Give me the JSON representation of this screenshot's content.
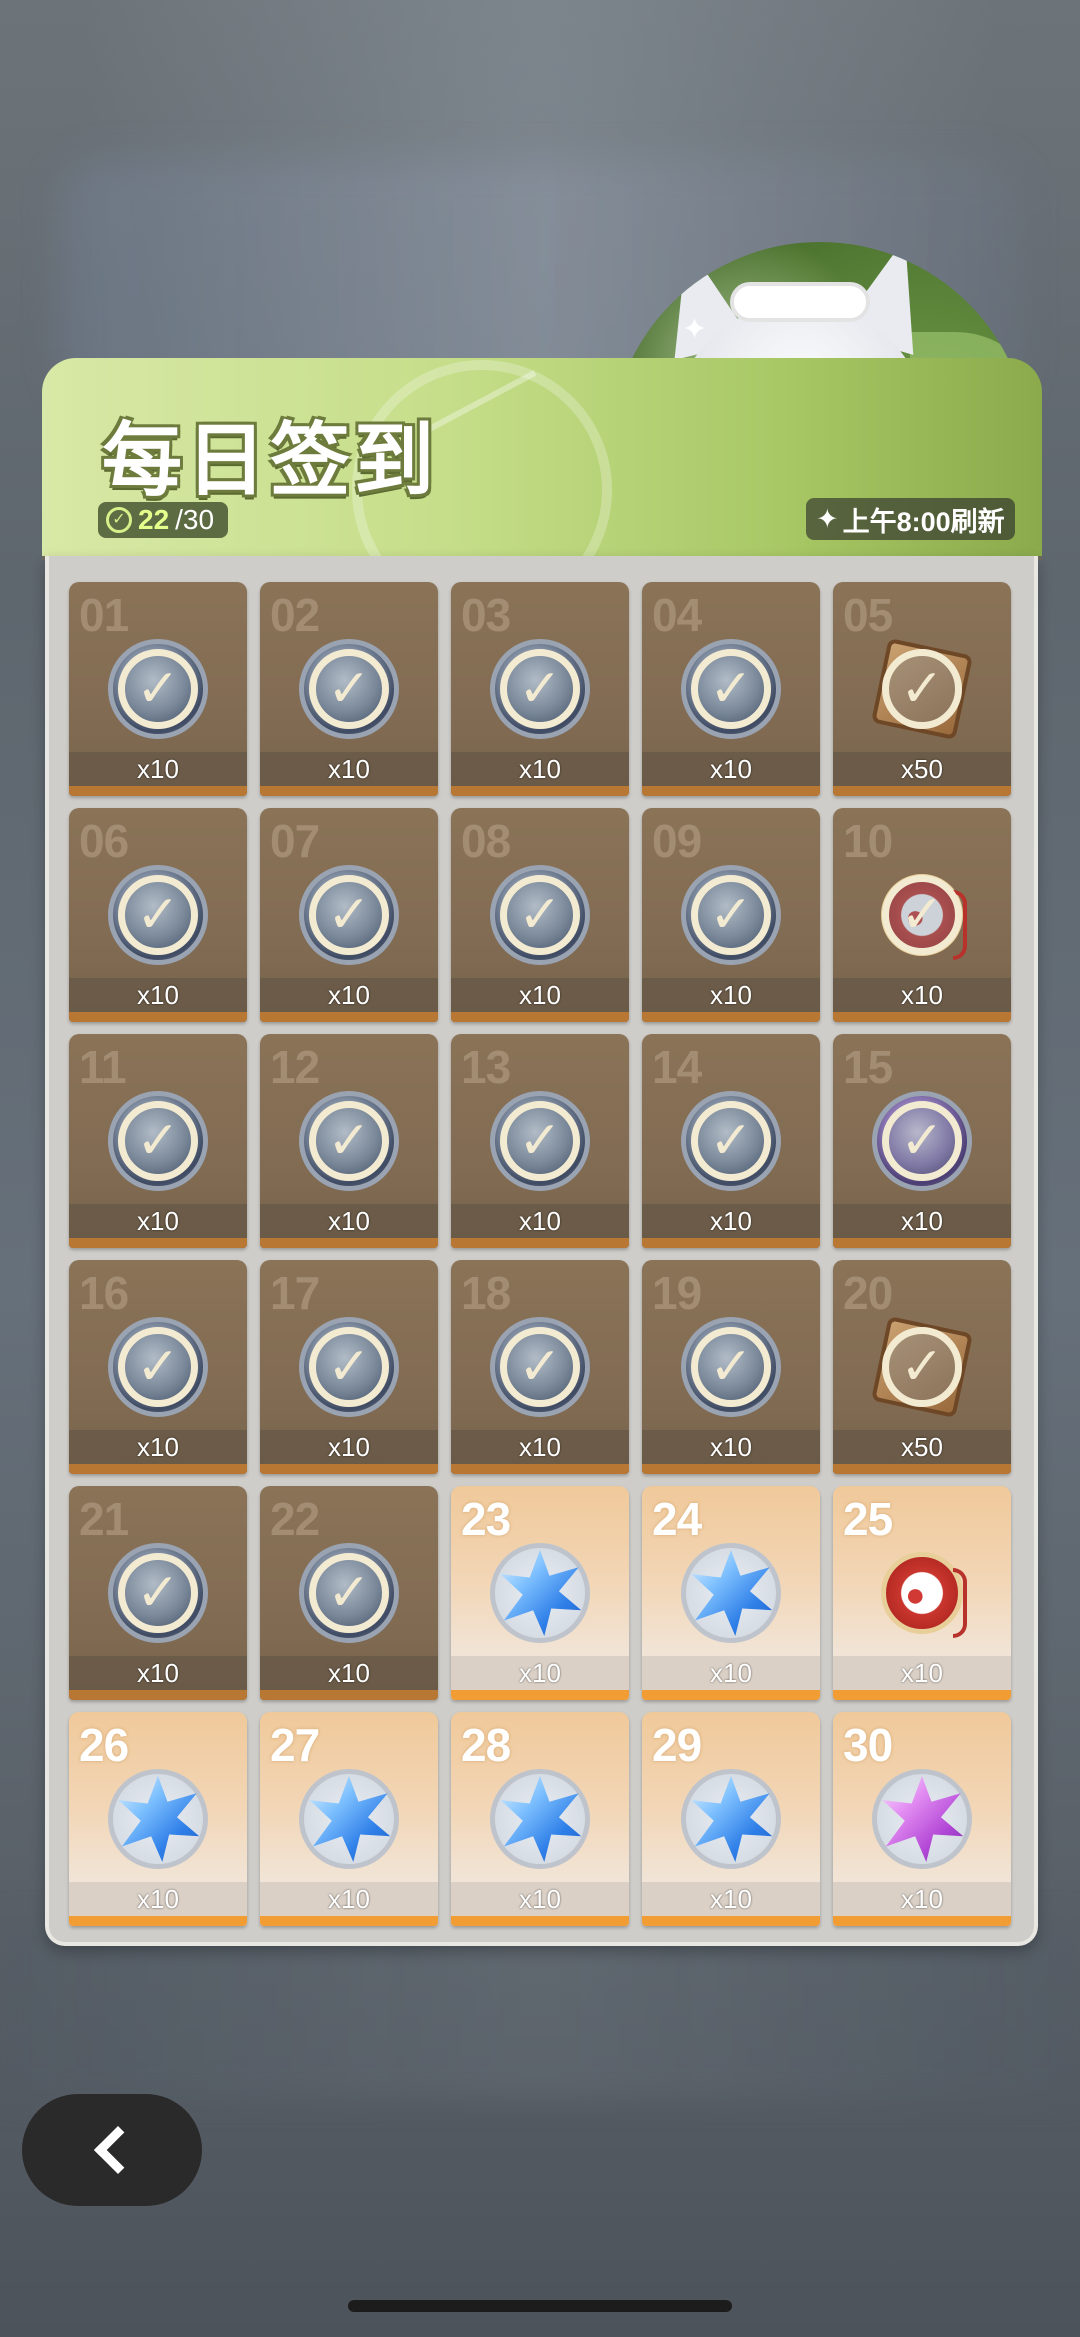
{
  "header": {
    "title": "每日签到",
    "progress_current": "22",
    "progress_total": "/30",
    "refresh_text": "上午8:00刷新",
    "accent_color": "#c6de8a"
  },
  "days": [
    {
      "day": "01",
      "qty": "x10",
      "item": "medal",
      "claimed": true
    },
    {
      "day": "02",
      "qty": "x10",
      "item": "medal",
      "claimed": true
    },
    {
      "day": "03",
      "qty": "x10",
      "item": "medal",
      "claimed": true
    },
    {
      "day": "04",
      "qty": "x10",
      "item": "medal",
      "claimed": true
    },
    {
      "day": "05",
      "qty": "x50",
      "item": "ticket",
      "claimed": true
    },
    {
      "day": "06",
      "qty": "x10",
      "item": "medal",
      "claimed": true
    },
    {
      "day": "07",
      "qty": "x10",
      "item": "medal",
      "claimed": true
    },
    {
      "day": "08",
      "qty": "x10",
      "item": "medal",
      "claimed": true
    },
    {
      "day": "09",
      "qty": "x10",
      "item": "medal",
      "claimed": true
    },
    {
      "day": "10",
      "qty": "x10",
      "item": "paw-pouch",
      "claimed": true
    },
    {
      "day": "11",
      "qty": "x10",
      "item": "medal",
      "claimed": true
    },
    {
      "day": "12",
      "qty": "x10",
      "item": "medal",
      "claimed": true
    },
    {
      "day": "13",
      "qty": "x10",
      "item": "medal",
      "claimed": true
    },
    {
      "day": "14",
      "qty": "x10",
      "item": "medal",
      "claimed": true
    },
    {
      "day": "15",
      "qty": "x10",
      "item": "medal-purple",
      "claimed": true
    },
    {
      "day": "16",
      "qty": "x10",
      "item": "medal",
      "claimed": true
    },
    {
      "day": "17",
      "qty": "x10",
      "item": "medal",
      "claimed": true
    },
    {
      "day": "18",
      "qty": "x10",
      "item": "medal",
      "claimed": true
    },
    {
      "day": "19",
      "qty": "x10",
      "item": "medal",
      "claimed": true
    },
    {
      "day": "20",
      "qty": "x50",
      "item": "ticket",
      "claimed": true
    },
    {
      "day": "21",
      "qty": "x10",
      "item": "medal",
      "claimed": true
    },
    {
      "day": "22",
      "qty": "x10",
      "item": "medal",
      "claimed": true
    },
    {
      "day": "23",
      "qty": "x10",
      "item": "blue-crystal",
      "claimed": false
    },
    {
      "day": "24",
      "qty": "x10",
      "item": "blue-crystal",
      "claimed": false
    },
    {
      "day": "25",
      "qty": "x10",
      "item": "paw-pouch",
      "claimed": false
    },
    {
      "day": "26",
      "qty": "x10",
      "item": "blue-crystal",
      "claimed": false
    },
    {
      "day": "27",
      "qty": "x10",
      "item": "blue-crystal",
      "claimed": false
    },
    {
      "day": "28",
      "qty": "x10",
      "item": "blue-crystal",
      "claimed": false
    },
    {
      "day": "29",
      "qty": "x10",
      "item": "blue-crystal",
      "claimed": false
    },
    {
      "day": "30",
      "qty": "x10",
      "item": "purple-crystal",
      "claimed": false
    }
  ],
  "nav": {
    "back_icon": "chevron-left-icon"
  }
}
